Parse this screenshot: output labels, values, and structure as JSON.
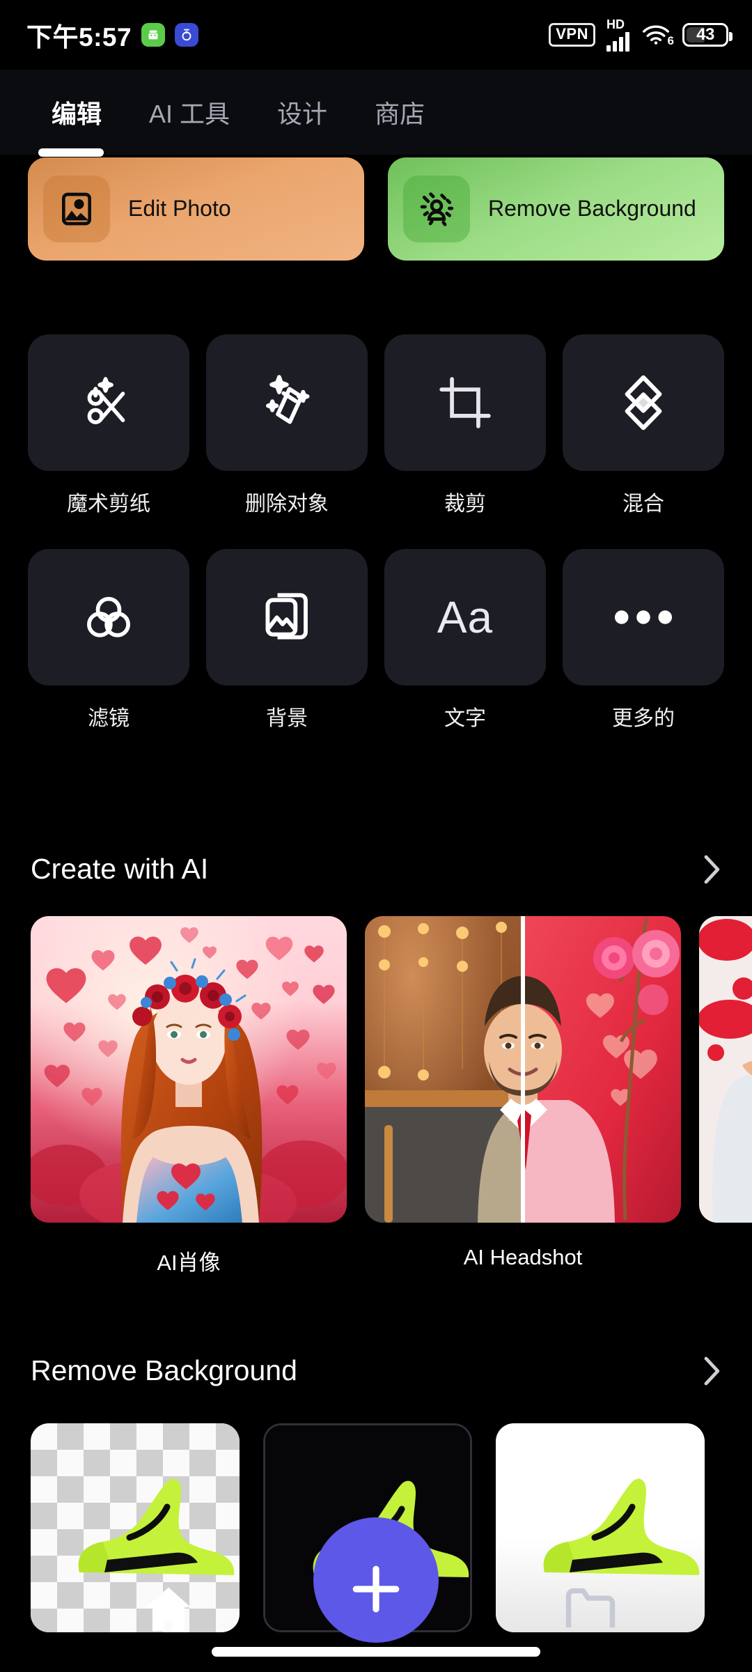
{
  "status_bar": {
    "time": "下午5:57",
    "app_badges": [
      {
        "name": "android-badge-icon",
        "color": "#5bcc4a"
      },
      {
        "name": "clock-badge-icon",
        "color": "#3b4ad3"
      }
    ],
    "vpn_label": "VPN",
    "hd_label": "HD",
    "wifi_generation": "6",
    "battery_percent": "43"
  },
  "tabs": [
    {
      "label": "编辑",
      "active": true
    },
    {
      "label": "AI 工具",
      "active": false
    },
    {
      "label": "设计",
      "active": false
    },
    {
      "label": "商店",
      "active": false
    }
  ],
  "hero_cards": [
    {
      "label": "Edit Photo",
      "icon": "photo-icon",
      "accent": "#eaa56d"
    },
    {
      "label": "Remove Background",
      "icon": "person-sparkle-icon",
      "accent": "#9ddd87"
    }
  ],
  "tools": [
    {
      "label": "魔术剪纸",
      "icon": "magic-scissors-icon"
    },
    {
      "label": "删除对象",
      "icon": "eraser-sparkle-icon"
    },
    {
      "label": "裁剪",
      "icon": "crop-icon"
    },
    {
      "label": "混合",
      "icon": "blend-diamond-icon"
    },
    {
      "label": "滤镜",
      "icon": "filter-circles-icon"
    },
    {
      "label": "背景",
      "icon": "background-image-icon"
    },
    {
      "label": "文字",
      "icon": "text-aa-icon"
    },
    {
      "label": "更多的",
      "icon": "more-dots-icon"
    }
  ],
  "sections": [
    {
      "title": "Create with AI",
      "chevron": "chevron-right-icon",
      "items": [
        {
          "caption": "AI肖像",
          "thumb": "ai-portrait-woman-hearts"
        },
        {
          "caption": "AI Headshot",
          "thumb": "ai-headshot-man-split"
        },
        {
          "caption": "",
          "thumb": "ai-rose-petals-partial"
        }
      ]
    },
    {
      "title": "Remove Background",
      "chevron": "chevron-right-icon",
      "items": [
        {
          "caption": "",
          "thumb": "shoe-transparent-checkerboard"
        },
        {
          "caption": "",
          "thumb": "shoe-black-background"
        },
        {
          "caption": "",
          "thumb": "shoe-white-background"
        }
      ]
    }
  ],
  "bottom_nav": {
    "home": "home-icon",
    "create": "plus-icon",
    "projects": "folder-icon",
    "fab_color": "#5d58e8"
  }
}
